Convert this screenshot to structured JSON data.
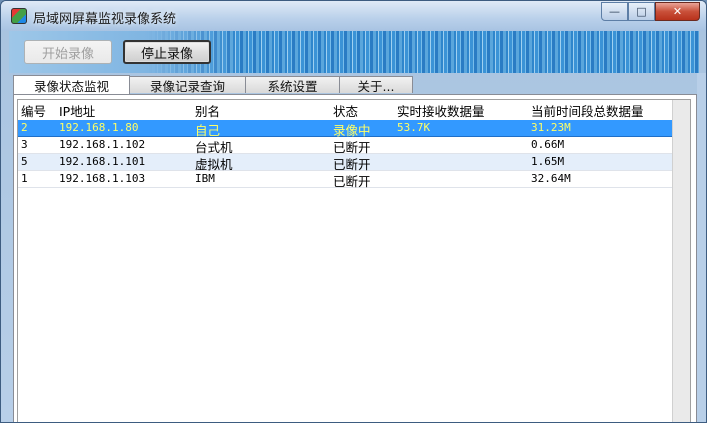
{
  "window": {
    "title": "局域网屏幕监视录像系统"
  },
  "controls": {
    "minimize": "—",
    "maximize": "□",
    "close": "✕"
  },
  "toolbar": {
    "start_label": "开始录像",
    "stop_label": "停止录像"
  },
  "tabs": [
    {
      "label": "录像状态监视",
      "active": true
    },
    {
      "label": "录像记录查询",
      "active": false
    },
    {
      "label": "系统设置",
      "active": false
    },
    {
      "label": "关于...",
      "active": false
    }
  ],
  "table": {
    "columns": [
      "编号",
      "IP地址",
      "别名",
      "状态",
      "实时接收数据量",
      "当前时间段总数据量"
    ],
    "rows": [
      {
        "id": "2",
        "ip": "192.168.1.80",
        "alias": "自己",
        "status": "录像中",
        "realtime": "53.7K",
        "total": "31.23M",
        "selected": true
      },
      {
        "id": "3",
        "ip": "192.168.1.102",
        "alias": "台式机",
        "status": "已断开",
        "realtime": "",
        "total": "0.66M",
        "selected": false
      },
      {
        "id": "5",
        "ip": "192.168.1.101",
        "alias": "虚拟机",
        "status": "已断开",
        "realtime": "",
        "total": "1.65M",
        "selected": false
      },
      {
        "id": "1",
        "ip": "192.168.1.103",
        "alias": "IBM",
        "status": "已断开",
        "realtime": "",
        "total": "32.64M",
        "selected": false
      }
    ]
  },
  "colors": {
    "selection": "#3399ff",
    "selection_text": "#ffff66",
    "alt_row": "#e4eefa"
  }
}
